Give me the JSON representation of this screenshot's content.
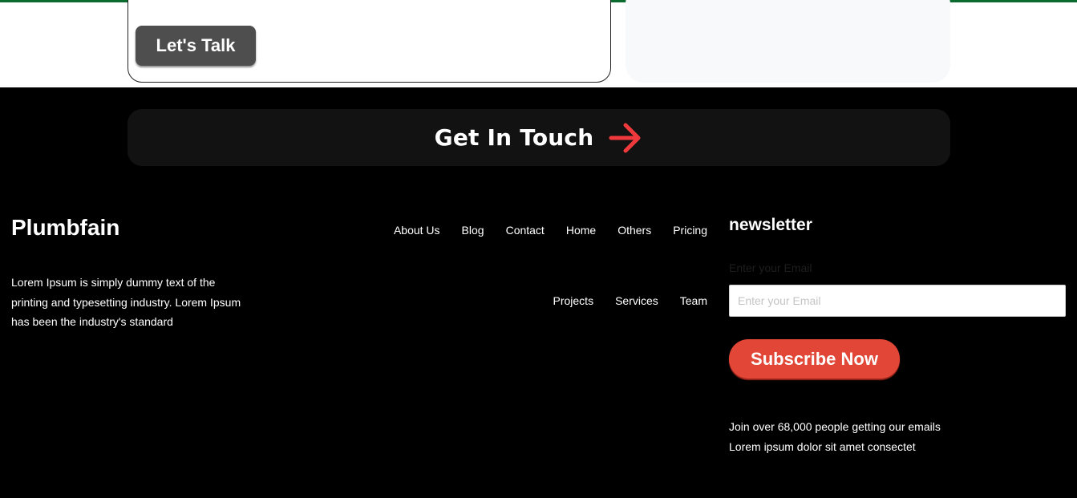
{
  "hero": {
    "talk_button": "Let's Talk"
  },
  "cta": {
    "label": "Get In Touch",
    "arrow_icon": "arrow-right-icon",
    "arrow_color": "#f0393c"
  },
  "footer": {
    "brand": "Plumbfain",
    "description": "Lorem Ipsum is simply dummy text of the printing and typesetting industry. Lorem Ipsum has been the industry's standard",
    "nav_row1": [
      "About Us",
      "Blog",
      "Contact",
      "Home",
      "Others",
      "Pricing"
    ],
    "nav_row2": [
      "Projects",
      "Services",
      "Team"
    ]
  },
  "newsletter": {
    "title": "newsletter",
    "label": "Enter your Email",
    "placeholder": "Enter your Email",
    "button": "Subscribe Now",
    "note_line1": "Join over 68,000 people getting our emails",
    "note_line2": "Lorem ipsum dolor sit amet consectet"
  },
  "colors": {
    "accent_red": "#e24637",
    "dark_button": "#4e4e4e",
    "top_border_green": "#0b6b2e"
  }
}
